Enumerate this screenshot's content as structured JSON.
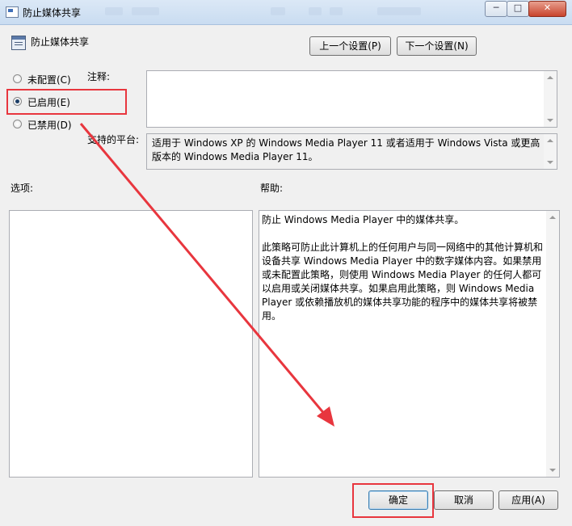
{
  "window": {
    "title": "防止媒体共享",
    "controls": {
      "minimize": "─",
      "maximize": "□",
      "close": "✕"
    }
  },
  "header": {
    "title": "防止媒体共享"
  },
  "nav": {
    "prev_label": "上一个设置(P)",
    "next_label": "下一个设置(N)"
  },
  "options": [
    {
      "label": "未配置(C)",
      "selected": false
    },
    {
      "label": "已启用(E)",
      "selected": true
    },
    {
      "label": "已禁用(D)",
      "selected": false
    }
  ],
  "comment": {
    "label": "注释:",
    "value": ""
  },
  "platform": {
    "label": "支持的平台:",
    "value": "适用于 Windows XP 的 Windows Media Player 11 或者适用于 Windows Vista 或更高版本的 Windows Media Player 11。"
  },
  "options_section": {
    "label": "选项:"
  },
  "help_section": {
    "label": "帮助:",
    "text": "防止 Windows Media Player 中的媒体共享。\n\n此策略可防止此计算机上的任何用户与同一网络中的其他计算机和设备共享 Windows Media Player 中的数字媒体内容。如果禁用或未配置此策略，则使用 Windows Media Player 的任何人都可以启用或关闭媒体共享。如果启用此策略，则 Windows Media Player 或依赖播放机的媒体共享功能的程序中的媒体共享将被禁用。"
  },
  "footer": {
    "ok_label": "确定",
    "cancel_label": "取消",
    "apply_label": "应用(A)"
  },
  "annotation_color": "#e8363e"
}
